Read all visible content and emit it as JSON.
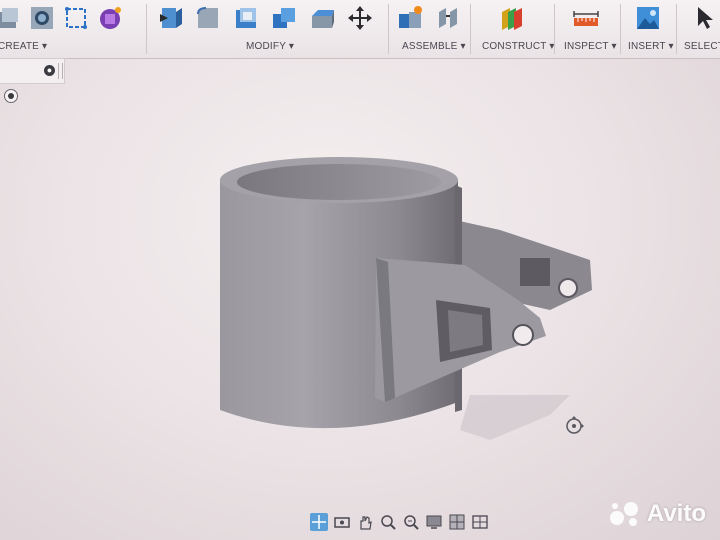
{
  "toolbar": {
    "groups": [
      {
        "label": "CREATE ▾"
      },
      {
        "label": "MODIFY ▾"
      },
      {
        "label": "ASSEMBLE ▾"
      },
      {
        "label": "CONSTRUCT ▾"
      },
      {
        "label": "INSPECT ▾"
      },
      {
        "label": "INSERT ▾"
      },
      {
        "label": "SELECT ▾"
      }
    ],
    "icons": {
      "create": [
        "extrude-icon",
        "hole-icon",
        "sketch-dimension-icon",
        "form-icon"
      ],
      "modify": [
        "press-pull-icon",
        "fillet-icon",
        "shell-icon",
        "combine-icon",
        "replace-face-icon",
        "move-icon"
      ],
      "assemble": [
        "new-component-icon",
        "joint-icon"
      ],
      "construct": [
        "offset-plane-icon"
      ],
      "inspect": [
        "measure-icon"
      ],
      "insert": [
        "insert-image-icon"
      ],
      "select": [
        "select-arrow-icon"
      ]
    }
  },
  "browser": {
    "collapse_symbol": "●"
  },
  "navbar": {
    "icons": [
      "orbit-constrained-icon",
      "look-at-icon",
      "pan-icon",
      "zoom-icon",
      "fit-icon",
      "display-settings-icon",
      "grid-icon",
      "viewports-icon"
    ]
  },
  "watermark": {
    "text": "Avito"
  },
  "colors": {
    "accent": "#5a9fd8",
    "model": "#8e8c93",
    "background": "#ece4e6"
  }
}
